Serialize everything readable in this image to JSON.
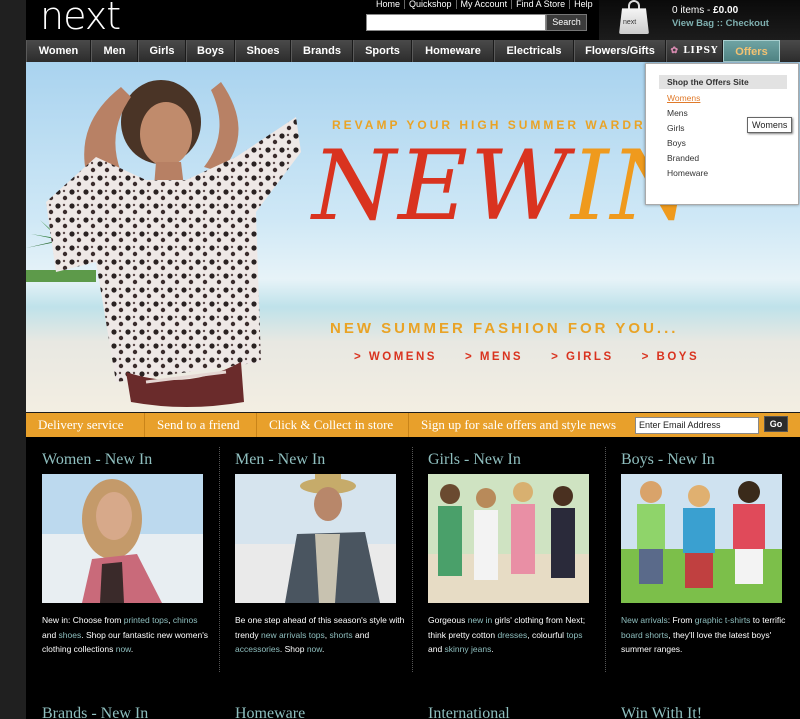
{
  "header": {
    "logo": "next",
    "top_links": [
      "Home",
      "Quickshop",
      "My Account",
      "Find A Store",
      "Help"
    ],
    "search_placeholder": "",
    "search_button": "Search",
    "bag_icon_text": "next",
    "bag_items": "0 items - ",
    "bag_total": "£0.00",
    "bag_links": "View Bag :: Checkout"
  },
  "nav": {
    "items": [
      "Women",
      "Men",
      "Girls",
      "Boys",
      "Shoes",
      "Brands",
      "Sports",
      "Homeware",
      "Electricals",
      "Flowers/Gifts",
      "LIPSY",
      "Offers"
    ]
  },
  "hero": {
    "revamp": "REVAMP YOUR HIGH SUMMER WARDRO",
    "newin_part1": "NEW",
    "newin_part2": "IN",
    "summer": "NEW SUMMER FASHION FOR YOU...",
    "cats": [
      "> WOMENS",
      "> MENS",
      "> GIRLS",
      "> BOYS"
    ]
  },
  "offers_dropdown": {
    "title": "Shop the Offers Site",
    "items": [
      "Womens",
      "Mens",
      "Girls",
      "Boys",
      "Branded",
      "Homeware"
    ],
    "tooltip": "Womens"
  },
  "service_bar": {
    "items": [
      "Delivery service",
      "Send to a friend",
      "Click & Collect in store",
      "Sign up for sale offers and style news"
    ],
    "email_value": "Enter Email Address",
    "go": "Go"
  },
  "columns": [
    {
      "title": "Women - New In",
      "desc": [
        {
          "t": "New in: Choose from "
        },
        {
          "t": "printed tops",
          "link": true
        },
        {
          "t": ", "
        },
        {
          "t": "chinos",
          "link": true
        },
        {
          "t": " and "
        },
        {
          "t": "shoes",
          "link": true
        },
        {
          "t": ". Shop our fantastic new women's clothing collections "
        },
        {
          "t": "now",
          "link": true
        },
        {
          "t": "."
        }
      ],
      "bottom": "Brands - New In"
    },
    {
      "title": "Men - New In",
      "desc": [
        {
          "t": "Be one step ahead of this season's style with trendy "
        },
        {
          "t": "new arrivals tops",
          "link": true
        },
        {
          "t": ", "
        },
        {
          "t": "shorts",
          "link": true
        },
        {
          "t": " and "
        },
        {
          "t": "accessories",
          "link": true
        },
        {
          "t": ". Shop "
        },
        {
          "t": "now",
          "link": true
        },
        {
          "t": "."
        }
      ],
      "bottom": "Homeware"
    },
    {
      "title": "Girls - New In",
      "desc": [
        {
          "t": "Gorgeous "
        },
        {
          "t": "new in",
          "link": true
        },
        {
          "t": " girls' clothing from Next; think pretty cotton "
        },
        {
          "t": "dresses",
          "link": true
        },
        {
          "t": ", colourful "
        },
        {
          "t": "tops",
          "link": true
        },
        {
          "t": " and "
        },
        {
          "t": "skinny jeans",
          "link": true
        },
        {
          "t": "."
        }
      ],
      "bottom": "International"
    },
    {
      "title": "Boys - New In",
      "desc": [
        {
          "t": "New arrivals",
          "link": true
        },
        {
          "t": ": From "
        },
        {
          "t": "graphic t-shirts",
          "link": true
        },
        {
          "t": " to terrific "
        },
        {
          "t": "board shorts",
          "link": true
        },
        {
          "t": ", they'll love the latest boys' summer ranges."
        }
      ],
      "bottom": "Win With It!"
    }
  ],
  "colors": {
    "accent_orange": "#e8a02b",
    "teal": "#8fbfbf",
    "red": "#d9331f"
  }
}
